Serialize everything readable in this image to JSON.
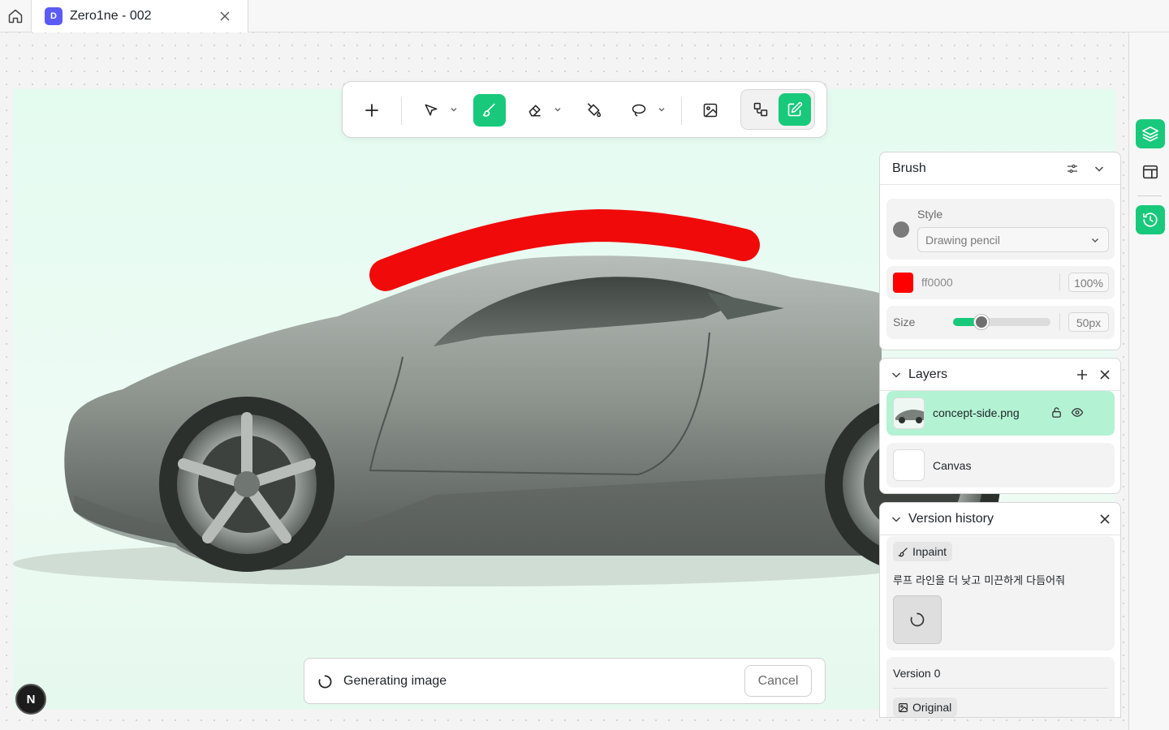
{
  "app": {
    "tab": {
      "badge": "D",
      "title": "Zero1ne - 002"
    }
  },
  "toolbar": {
    "tools": [
      "add",
      "select",
      "brush",
      "eraser",
      "fill",
      "lasso",
      "image",
      "shapes",
      "edit"
    ],
    "active_tool": "brush"
  },
  "brush_panel": {
    "title": "Brush",
    "style_label": "Style",
    "style_value": "Drawing pencil",
    "color_hex": "ff0000",
    "opacity": "100%",
    "size_label": "Size",
    "size_value": "50px",
    "size_fraction": 0.25,
    "swatch_color": "#ff0000"
  },
  "layers_panel": {
    "title": "Layers",
    "items": [
      {
        "name": "concept-side.png",
        "selected": true
      },
      {
        "name": "Canvas",
        "selected": false
      }
    ]
  },
  "version_panel": {
    "title": "Version history",
    "entry_tag": "Inpaint",
    "entry_prompt": "루프 라인을 더 낮고 미끈하게 다듬어줘",
    "version_label": "Version 0",
    "version_tag": "Original"
  },
  "status": {
    "generating_text": "Generating image",
    "cancel_label": "Cancel"
  },
  "badge": {
    "letter": "N"
  },
  "colors": {
    "accent": "#18c97b",
    "stroke": "#f00a0a",
    "layer_selected": "#b3f3d4",
    "tab_badge": "#5b5bf6"
  }
}
